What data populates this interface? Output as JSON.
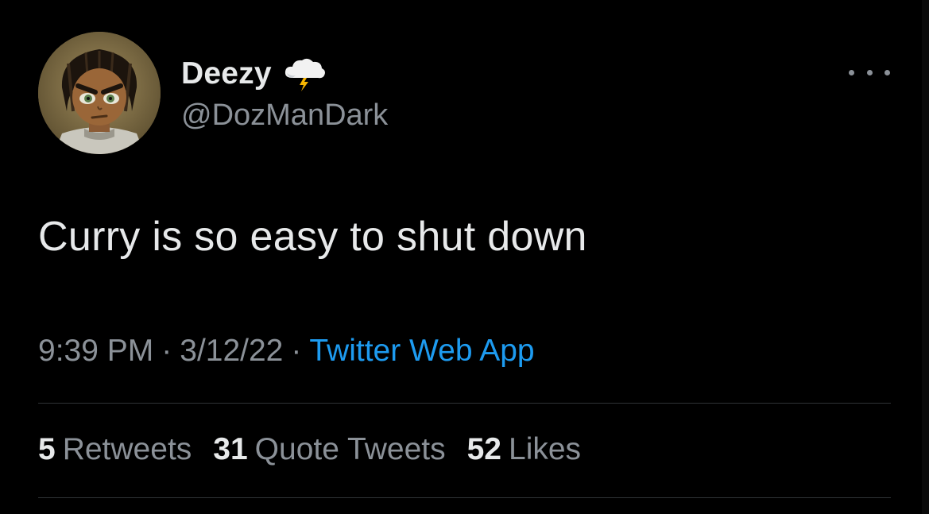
{
  "author": {
    "display_name": "Deezy",
    "handle": "@DozManDark",
    "avatar_icon": "cartoon-avatar",
    "name_emoji_icon": "cloud-with-lightning-icon"
  },
  "tweet": {
    "text": "Curry is so easy to shut down",
    "time": "9:39 PM",
    "separator": "·",
    "date": "3/12/22",
    "source": "Twitter Web App"
  },
  "stats": [
    {
      "count": "5",
      "label": "Retweets"
    },
    {
      "count": "31",
      "label": "Quote Tweets"
    },
    {
      "count": "52",
      "label": "Likes"
    }
  ],
  "colors": {
    "background": "#000000",
    "primary_text": "#e7e9ea",
    "secondary_text": "#8b9198",
    "link": "#1d9bf0",
    "divider": "#2f3336"
  }
}
